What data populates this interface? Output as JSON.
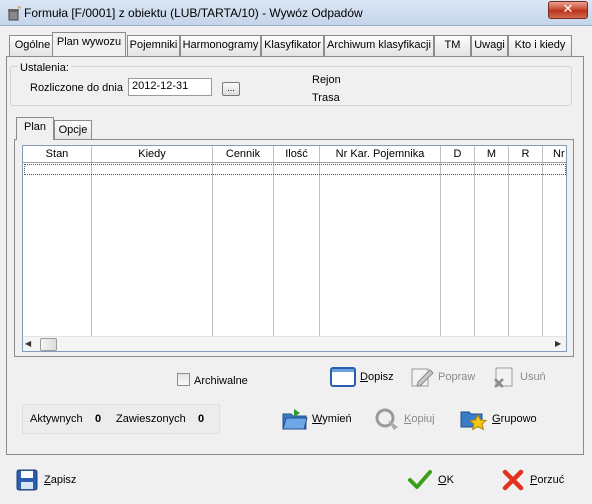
{
  "window": {
    "title": "Formuła [F/0001] z obiektu (LUB/TARTA/10) - Wywóz Odpadów",
    "close_glyph": "✕"
  },
  "main_tabs": [
    {
      "label": "Ogólne"
    },
    {
      "label": "Plan wywozu"
    },
    {
      "label": "Pojemniki"
    },
    {
      "label": "Harmonogramy"
    },
    {
      "label": "Klasyfikator"
    },
    {
      "label": "Archiwum klasyfikacji"
    },
    {
      "label": "TM"
    },
    {
      "label": "Uwagi"
    },
    {
      "label": "Kto i kiedy"
    }
  ],
  "active_main_tab": "Plan wywozu",
  "ustalenia": {
    "group_label": "Ustalenia:",
    "rozliczone_label": "Rozliczone do dnia",
    "rozliczone_value": "2012-12-31",
    "browse_label": "...",
    "rejon_label": "Rejon",
    "trasa_label": "Trasa"
  },
  "inner_tabs": [
    {
      "label": "Plan"
    },
    {
      "label": "Opcje"
    }
  ],
  "table": {
    "columns": [
      "Stan",
      "Kiedy",
      "Cennik",
      "Ilość",
      "Nr Kar. Pojemnika",
      "D",
      "M",
      "R",
      "Nr"
    ],
    "rows": []
  },
  "archiwalne": {
    "label": "Archiwalne",
    "checked": false
  },
  "actions": {
    "dopisz": "Dopisz",
    "popraw": "Popraw",
    "usun": "Usuń",
    "wymien": "Wymień",
    "kopiuj": "Kopiuj",
    "grupowo": "Grupowo"
  },
  "counters": {
    "aktywnych_label": "Aktywnych",
    "aktywnych_value": "0",
    "zawieszonych_label": "Zawieszonych",
    "zawieszonych_value": "0"
  },
  "bottom": {
    "zapisz": "Zapisz",
    "ok": "OK",
    "porzuc": "Porzuć"
  },
  "colors": {
    "title_gradient_top": "#dbe6f4",
    "close_red": "#c7432b",
    "ok_green": "#3aa01c",
    "cancel_red": "#e0321c",
    "save_blue": "#2a5fb0"
  }
}
